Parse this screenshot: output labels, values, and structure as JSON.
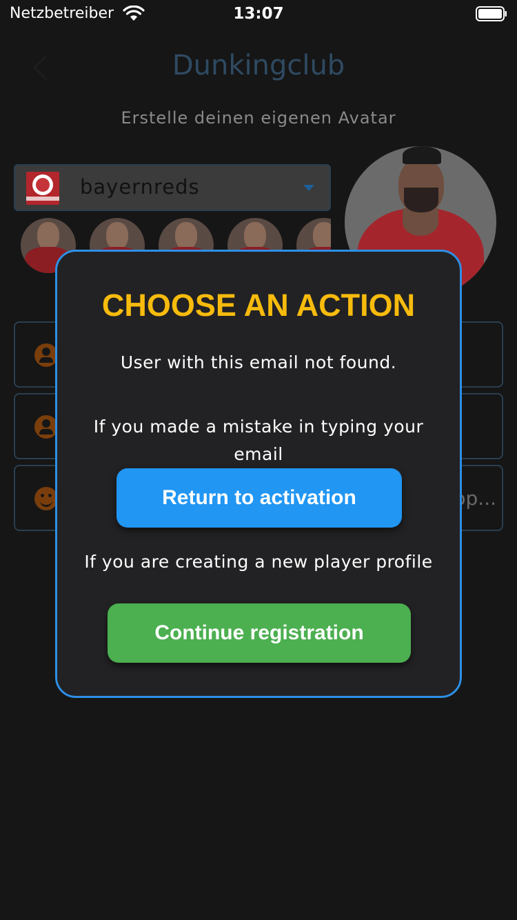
{
  "status_bar": {
    "carrier": "Netzbetreiber",
    "time": "13:07"
  },
  "header": {
    "title": "Dunkingclub",
    "subtitle": "Erstelle deinen eigenen Avatar"
  },
  "team_select": {
    "selected": "bayernreds"
  },
  "form": {
    "field3_trailing": "op..."
  },
  "dialog": {
    "title": "CHOOSE AN ACTION",
    "message": "User with this email not found.",
    "hint_mistake": "If you made a mistake in typing your email",
    "return_label": "Return to activation",
    "hint_new": "If you are creating a new player profile",
    "continue_label": "Continue registration"
  },
  "colors": {
    "title_accent": "#f7bb0d",
    "dialog_border": "#2d8fe6",
    "return_button": "#2196f3",
    "continue_button": "#4caf50"
  },
  "icons": {
    "back": "chevron-left-icon",
    "wifi": "wifi-icon",
    "battery": "battery-icon",
    "field1": "person-icon",
    "field2": "person-icon",
    "field3": "smile-icon",
    "dropdown": "caret-down-icon"
  }
}
